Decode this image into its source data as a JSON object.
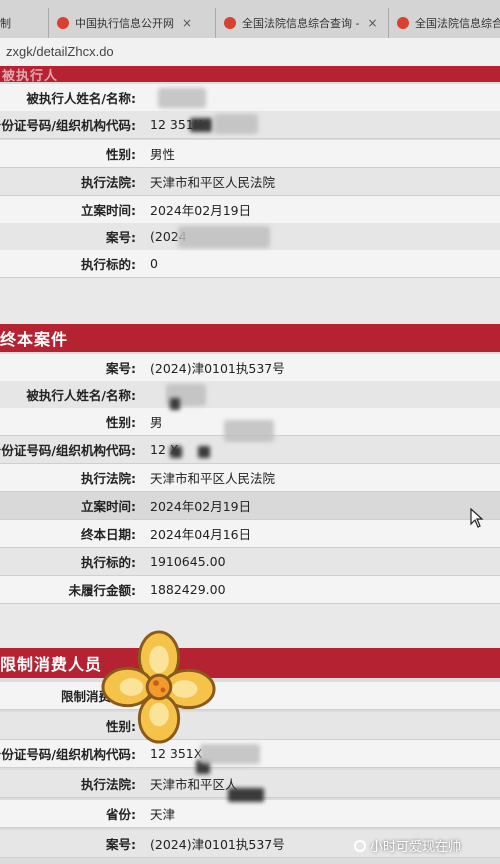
{
  "browser": {
    "tabs": [
      {
        "label": "制"
      },
      {
        "label": "中国执行信息公开网"
      },
      {
        "label": "全国法院信息综合查询 -"
      },
      {
        "label": "全国法院信息综合查"
      }
    ],
    "address": "zxgk/detailZhcx.do"
  },
  "sections": [
    {
      "title": "被执行人",
      "rows": [
        {
          "label": "被执行人姓名/名称:",
          "value": ""
        },
        {
          "label": "身份证号码/组织机构代码:",
          "value": "12           351X"
        },
        {
          "label": "性别:",
          "value": "男性"
        },
        {
          "label": "执行法院:",
          "value": "天津市和平区人民法院"
        },
        {
          "label": "立案时间:",
          "value": "2024年02月19日"
        },
        {
          "label": "案号:",
          "value": "(2024"
        },
        {
          "label": "执行标的:",
          "value": "0"
        }
      ]
    },
    {
      "title": "终本案件",
      "rows": [
        {
          "label": "案号:",
          "value": "(2024)津0101执537号"
        },
        {
          "label": "被执行人姓名/名称:",
          "value": ""
        },
        {
          "label": "性别:",
          "value": "男"
        },
        {
          "label": "身份证号码/组织机构代码:",
          "value": "12           X"
        },
        {
          "label": "执行法院:",
          "value": "天津市和平区人民法院"
        },
        {
          "label": "立案时间:",
          "value": "2024年02月19日"
        },
        {
          "label": "终本日期:",
          "value": "2024年04月16日"
        },
        {
          "label": "执行标的:",
          "value": "1910645.00"
        },
        {
          "label": "未履行金额:",
          "value": "1882429.00"
        }
      ]
    },
    {
      "title": "限制消费人员",
      "rows": [
        {
          "label": "限制消费人员",
          "value": ""
        },
        {
          "label": "性别:",
          "value": ""
        },
        {
          "label": "身份证号码/组织机构代码:",
          "value": "12           351X"
        },
        {
          "label": "执行法院:",
          "value": "天津市和平区人"
        },
        {
          "label": "省份:",
          "value": "天津"
        },
        {
          "label": "案号:",
          "value": "(2024)津0101执537号"
        }
      ]
    }
  ],
  "watermark": "小时可爱现在帅"
}
